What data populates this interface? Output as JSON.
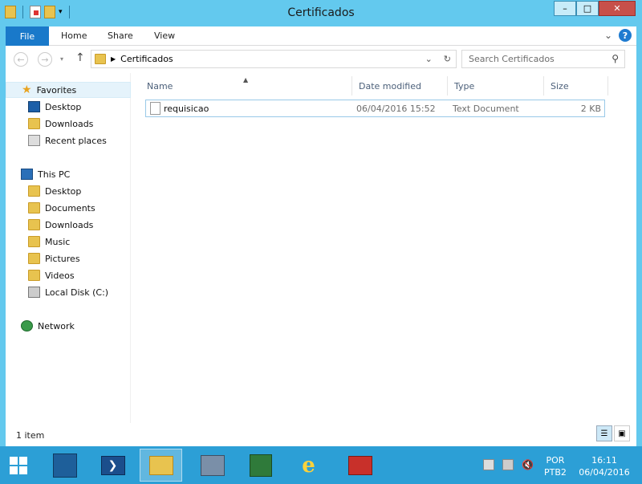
{
  "window": {
    "title": "Certificados",
    "minimize_label": "–",
    "maximize_label": "□",
    "close_label": "✕"
  },
  "ribbon": {
    "tabs": [
      "File",
      "Home",
      "Share",
      "View"
    ],
    "expand_label": "⌄",
    "help_label": "?"
  },
  "address": {
    "crumb": "Certificados",
    "search_placeholder": "Search Certificados"
  },
  "sidebar": {
    "favorites": {
      "label": "Favorites",
      "items": [
        "Desktop",
        "Downloads",
        "Recent places"
      ]
    },
    "this_pc": {
      "label": "This PC",
      "items": [
        "Desktop",
        "Documents",
        "Downloads",
        "Music",
        "Pictures",
        "Videos",
        "Local Disk (C:)"
      ]
    },
    "network": {
      "label": "Network"
    }
  },
  "columns": [
    "Name",
    "Date modified",
    "Type",
    "Size"
  ],
  "files": [
    {
      "name": "requisicao",
      "date": "06/04/2016 15:52",
      "type": "Text Document",
      "size": "2 KB"
    }
  ],
  "status": {
    "count": "1 item"
  },
  "taskbar": {
    "apps": [
      "start-button",
      "server-manager-icon",
      "powershell-icon",
      "file-explorer-icon",
      "remote-desktop-icon",
      "network-policy-icon",
      "internet-explorer-icon",
      "toolbox-icon"
    ],
    "lang_line1": "POR",
    "lang_line2": "PTB2",
    "time": "16:11",
    "date": "06/04/2016"
  },
  "colors": {
    "accent": "#63c9ee",
    "file_tab": "#1979ca",
    "taskbar": "#2c9fd6",
    "close": "#c7504a"
  }
}
